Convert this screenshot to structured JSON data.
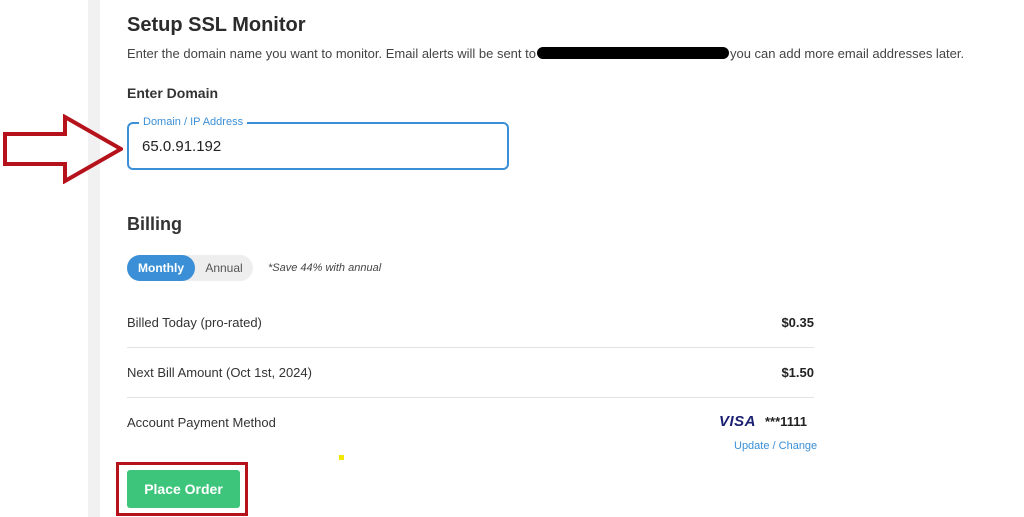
{
  "page": {
    "title": "Setup SSL Monitor",
    "intro_before": "Enter the domain name you want to monitor. Email alerts will be sent to",
    "intro_after": "you can add more email addresses later."
  },
  "domain": {
    "section_label": "Enter Domain",
    "field_label": "Domain / IP Address",
    "value": "65.0.91.192"
  },
  "billing": {
    "title": "Billing",
    "toggle": {
      "monthly": "Monthly",
      "annual": "Annual",
      "selected": "Monthly"
    },
    "save_note": "*Save 44% with annual",
    "rows": [
      {
        "label": "Billed Today (pro-rated)",
        "amount": "$0.35"
      },
      {
        "label": "Next Bill Amount (Oct 1st, 2024)",
        "amount": "$1.50"
      }
    ],
    "payment": {
      "label": "Account Payment Method",
      "card_brand": "VISA",
      "card_masked": "***1111",
      "update_link": "Update / Change"
    }
  },
  "actions": {
    "place_order": "Place Order"
  },
  "colors": {
    "accent": "#3b8fd6",
    "button_green": "#3ec57c",
    "annotation_red": "#b5121b",
    "visa_blue": "#1a1f71"
  },
  "icons": [
    "right-arrow-annotation-icon"
  ]
}
